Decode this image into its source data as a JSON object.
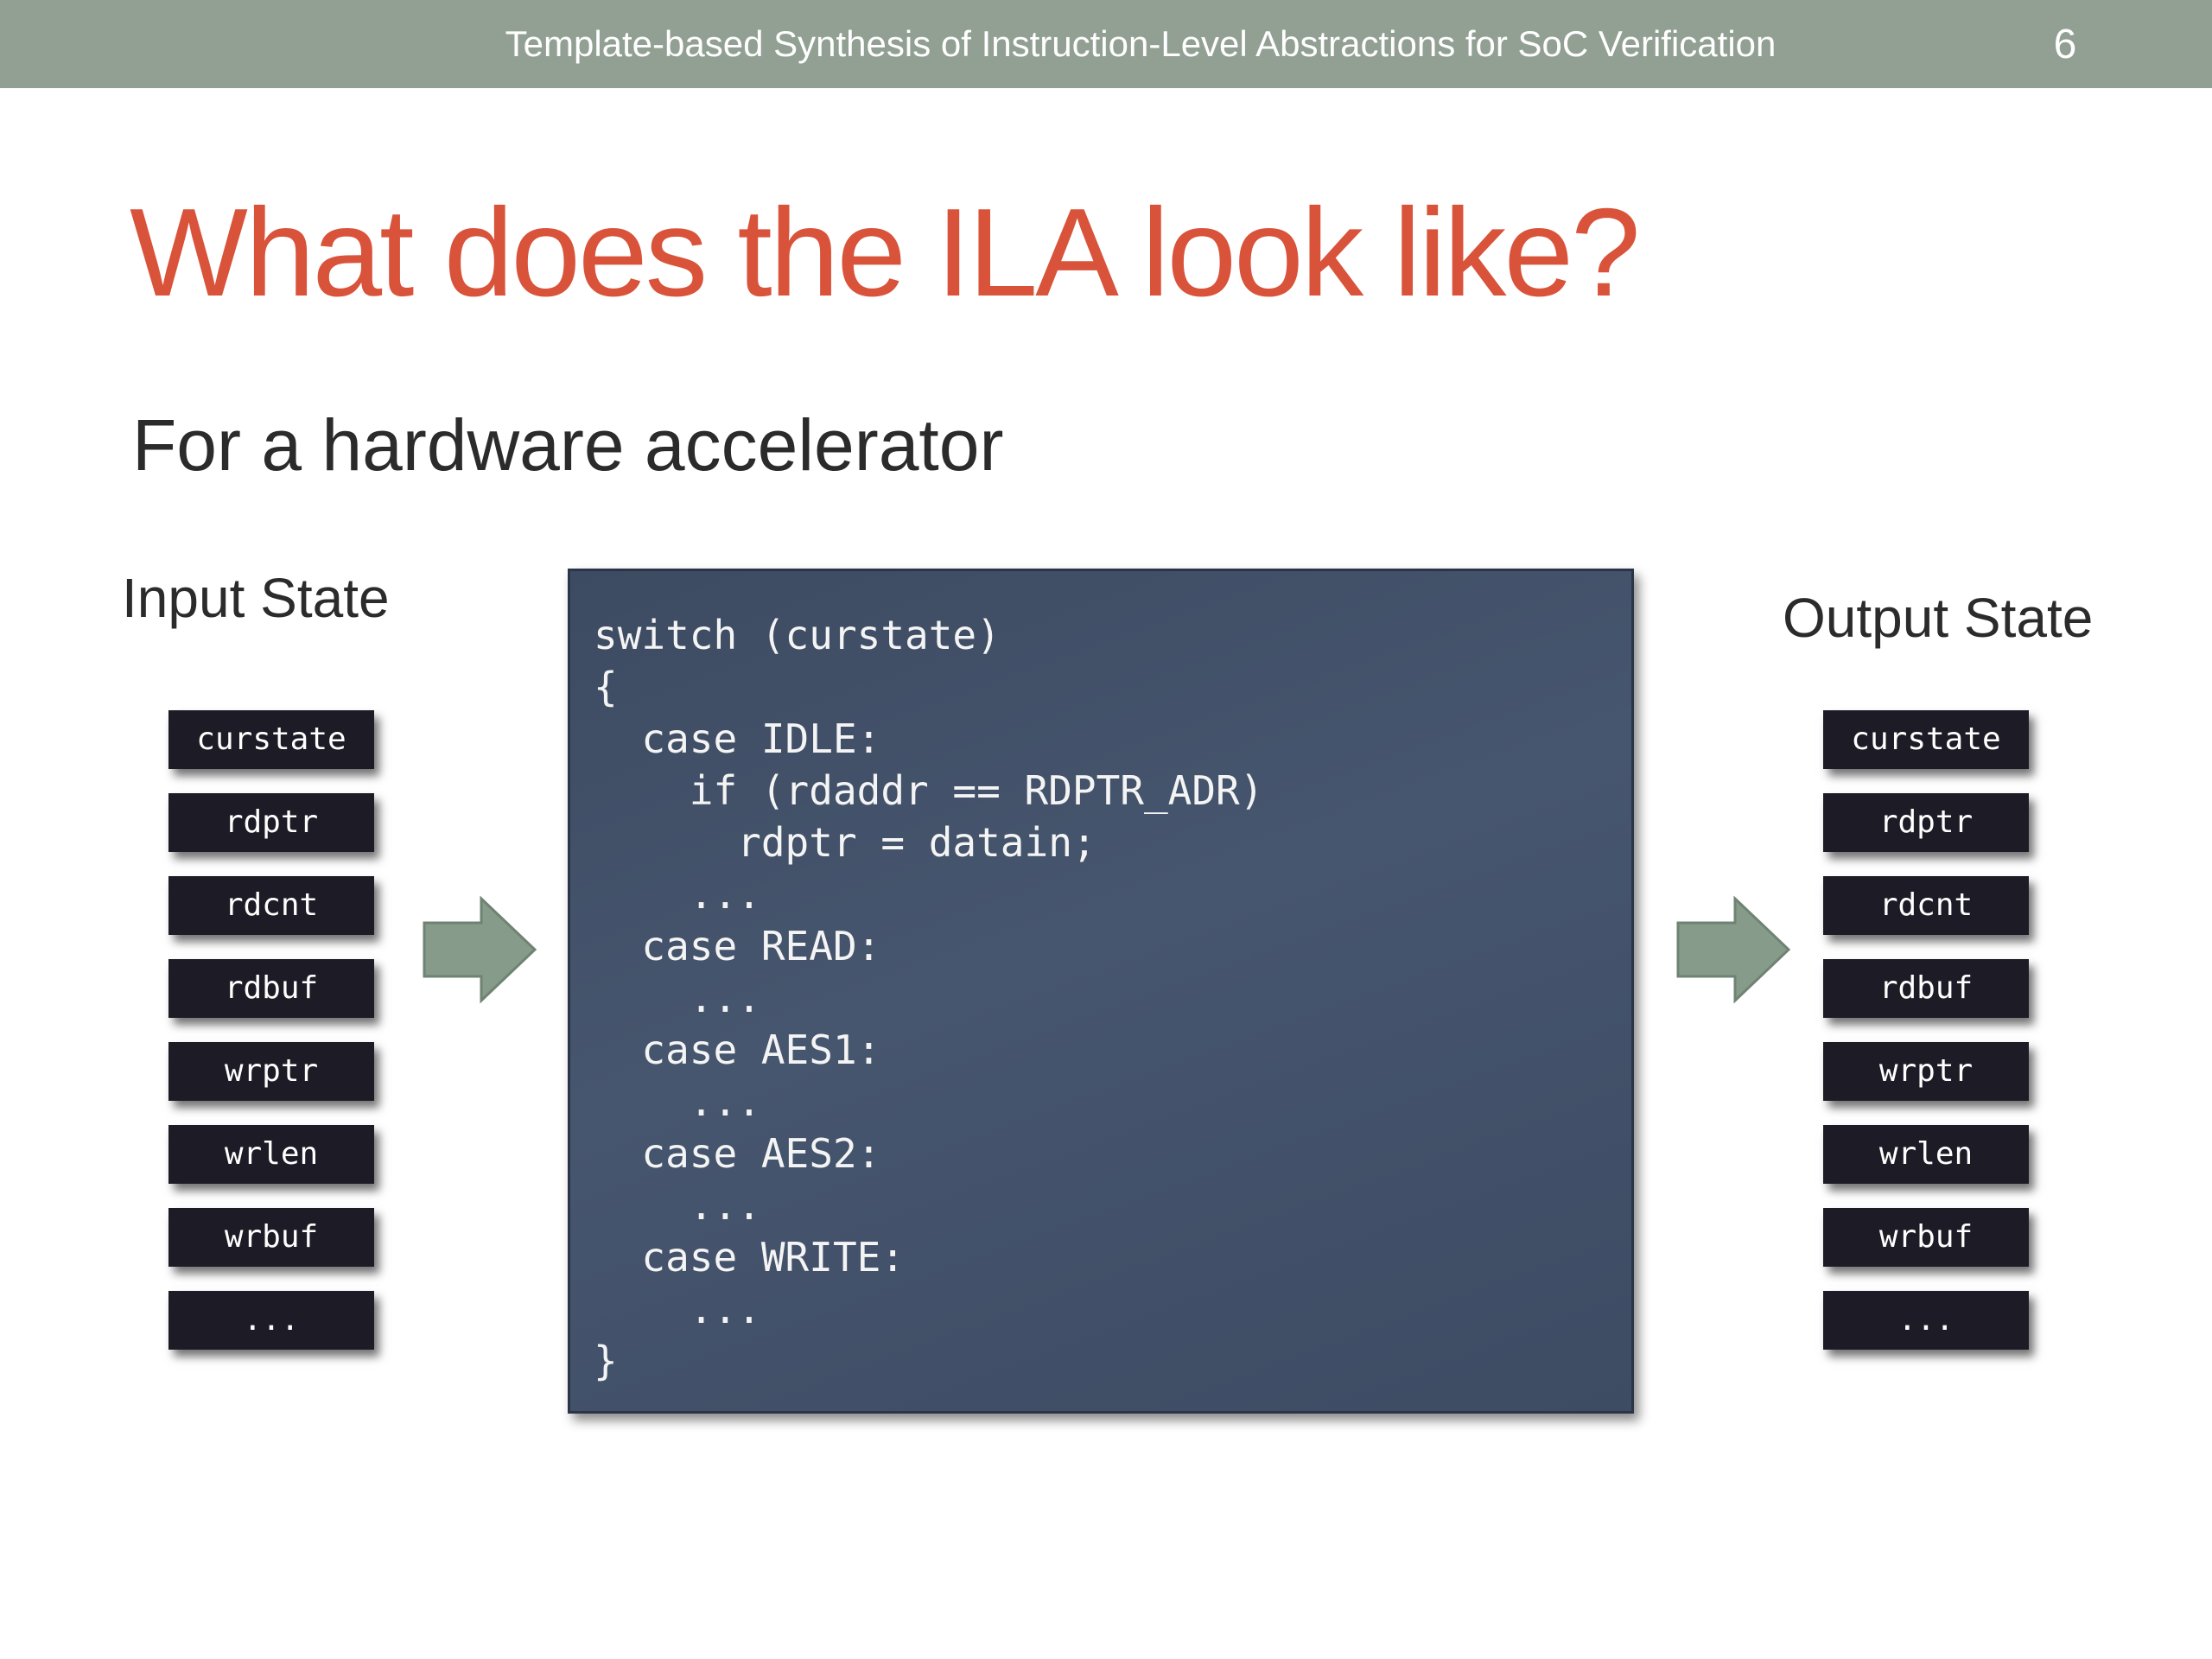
{
  "header": {
    "title": "Template-based Synthesis of Instruction-Level Abstractions for SoC Verification",
    "slide_number": "6"
  },
  "slide": {
    "title": "What does the ILA look like?",
    "subtitle": "For a hardware accelerator"
  },
  "input_state": {
    "heading": "Input State",
    "items": [
      "curstate",
      "rdptr",
      "rdcnt",
      "rdbuf",
      "wrptr",
      "wrlen",
      "wrbuf",
      "..."
    ]
  },
  "output_state": {
    "heading": "Output State",
    "items": [
      "curstate",
      "rdptr",
      "rdcnt",
      "rdbuf",
      "wrptr",
      "wrlen",
      "wrbuf",
      "..."
    ]
  },
  "code": {
    "lines": [
      "switch (curstate)",
      "{",
      "  case IDLE:",
      "    if (rdaddr == RDPTR_ADR)",
      "      rdptr = datain;",
      "    ...",
      "  case READ:",
      "    ...",
      "  case AES1:",
      "    ...",
      "  case AES2:",
      "    ...",
      "  case WRITE:",
      "    ...",
      "}"
    ]
  },
  "colors": {
    "header_bar": "#929f93",
    "title": "#d9533b",
    "code_panel": "#434f66",
    "state_box": "#1d1c26",
    "arrow": "#879b8a"
  },
  "icons": {
    "arrows": "right-arrow-icon"
  }
}
